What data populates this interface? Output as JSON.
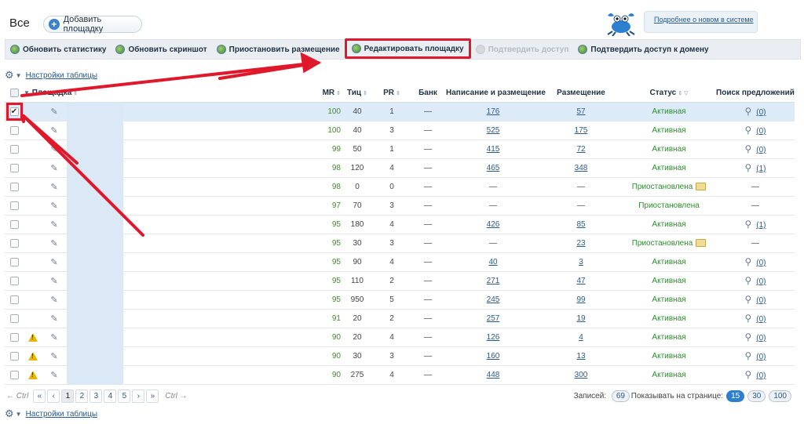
{
  "header": {
    "title": "Все",
    "add_button": "Добавить площадку",
    "news_link": "Подробнее о новом в системе"
  },
  "toolbar": [
    {
      "label": "Обновить статистику",
      "disabled": false,
      "highlight": false
    },
    {
      "label": "Обновить скриншот",
      "disabled": false,
      "highlight": false
    },
    {
      "label": "Приостановить размещение",
      "disabled": false,
      "highlight": false
    },
    {
      "label": "Редактировать площадку",
      "disabled": false,
      "highlight": true
    },
    {
      "label": "Подтвердить доступ",
      "disabled": true,
      "highlight": false
    },
    {
      "label": "Подтвердить доступ к домену",
      "disabled": false,
      "highlight": false
    }
  ],
  "table_settings_label": "Настройки таблицы",
  "columns": {
    "site": "Площадка",
    "mr": "MR",
    "tic": "Тиц",
    "pr": "PR",
    "bank": "Банк",
    "writing": "Написание и размещение",
    "placement": "Размещение",
    "status": "Статус",
    "search": "Поиск предложений"
  },
  "rows": [
    {
      "checked": true,
      "warn": false,
      "mr": "100",
      "tic": "40",
      "pr": "1",
      "bank": "—",
      "writing": "176",
      "placement": "57",
      "status": "Активная",
      "folder": false,
      "search": "(0)"
    },
    {
      "checked": false,
      "warn": false,
      "mr": "100",
      "tic": "40",
      "pr": "3",
      "bank": "—",
      "writing": "525",
      "placement": "175",
      "status": "Активная",
      "folder": false,
      "search": "(0)"
    },
    {
      "checked": false,
      "warn": false,
      "mr": "99",
      "tic": "50",
      "pr": "1",
      "bank": "—",
      "writing": "415",
      "placement": "72",
      "status": "Активная",
      "folder": false,
      "search": "(0)"
    },
    {
      "checked": false,
      "warn": false,
      "mr": "98",
      "tic": "120",
      "pr": "4",
      "bank": "—",
      "writing": "465",
      "placement": "348",
      "status": "Активная",
      "folder": false,
      "search": "(1)"
    },
    {
      "checked": false,
      "warn": false,
      "mr": "98",
      "tic": "0",
      "pr": "0",
      "bank": "—",
      "writing": "—",
      "placement": "—",
      "status": "Приостановлена",
      "folder": true,
      "search": "—"
    },
    {
      "checked": false,
      "warn": false,
      "mr": "97",
      "tic": "70",
      "pr": "3",
      "bank": "—",
      "writing": "—",
      "placement": "—",
      "status": "Приостановлена",
      "folder": false,
      "search": "—"
    },
    {
      "checked": false,
      "warn": false,
      "mr": "95",
      "tic": "180",
      "pr": "4",
      "bank": "—",
      "writing": "426",
      "placement": "85",
      "status": "Активная",
      "folder": false,
      "search": "(1)"
    },
    {
      "checked": false,
      "warn": false,
      "mr": "95",
      "tic": "30",
      "pr": "3",
      "bank": "—",
      "writing": "—",
      "placement": "23",
      "status": "Приостановлена",
      "folder": true,
      "search": "—"
    },
    {
      "checked": false,
      "warn": false,
      "mr": "95",
      "tic": "90",
      "pr": "4",
      "bank": "—",
      "writing": "40",
      "placement": "3",
      "status": "Активная",
      "folder": false,
      "search": "(0)"
    },
    {
      "checked": false,
      "warn": false,
      "mr": "95",
      "tic": "110",
      "pr": "2",
      "bank": "—",
      "writing": "271",
      "placement": "47",
      "status": "Активная",
      "folder": false,
      "search": "(0)"
    },
    {
      "checked": false,
      "warn": false,
      "mr": "95",
      "tic": "950",
      "pr": "5",
      "bank": "—",
      "writing": "245",
      "placement": "99",
      "status": "Активная",
      "folder": false,
      "search": "(0)"
    },
    {
      "checked": false,
      "warn": false,
      "mr": "91",
      "tic": "20",
      "pr": "2",
      "bank": "—",
      "writing": "257",
      "placement": "19",
      "status": "Активная",
      "folder": false,
      "search": "(0)"
    },
    {
      "checked": false,
      "warn": true,
      "mr": "90",
      "tic": "20",
      "pr": "4",
      "bank": "—",
      "writing": "126",
      "placement": "4",
      "status": "Активная",
      "folder": false,
      "search": "(0)"
    },
    {
      "checked": false,
      "warn": true,
      "mr": "90",
      "tic": "30",
      "pr": "3",
      "bank": "—",
      "writing": "160",
      "placement": "13",
      "status": "Активная",
      "folder": false,
      "search": "(0)"
    },
    {
      "checked": false,
      "warn": true,
      "mr": "90",
      "tic": "275",
      "pr": "4",
      "bank": "—",
      "writing": "448",
      "placement": "300",
      "status": "Активная",
      "folder": false,
      "search": "(0)"
    }
  ],
  "pager": {
    "prev_hint": "← Ctrl",
    "first": "«",
    "prev": "‹",
    "pages": [
      "1",
      "2",
      "3",
      "4",
      "5"
    ],
    "current": "1",
    "next": "›",
    "last": "»",
    "next_hint": "Ctrl →",
    "records_label": "Записей:",
    "records_count": "69",
    "per_page_label": "Показывать на странице:",
    "per_page_options": [
      "15",
      "30",
      "100"
    ],
    "per_page_current": "15"
  },
  "colors": {
    "annotation": "#e0182c",
    "active_status": "#2f8d2f",
    "mr_value": "#3f8f2a",
    "link": "#2a5b8c"
  }
}
